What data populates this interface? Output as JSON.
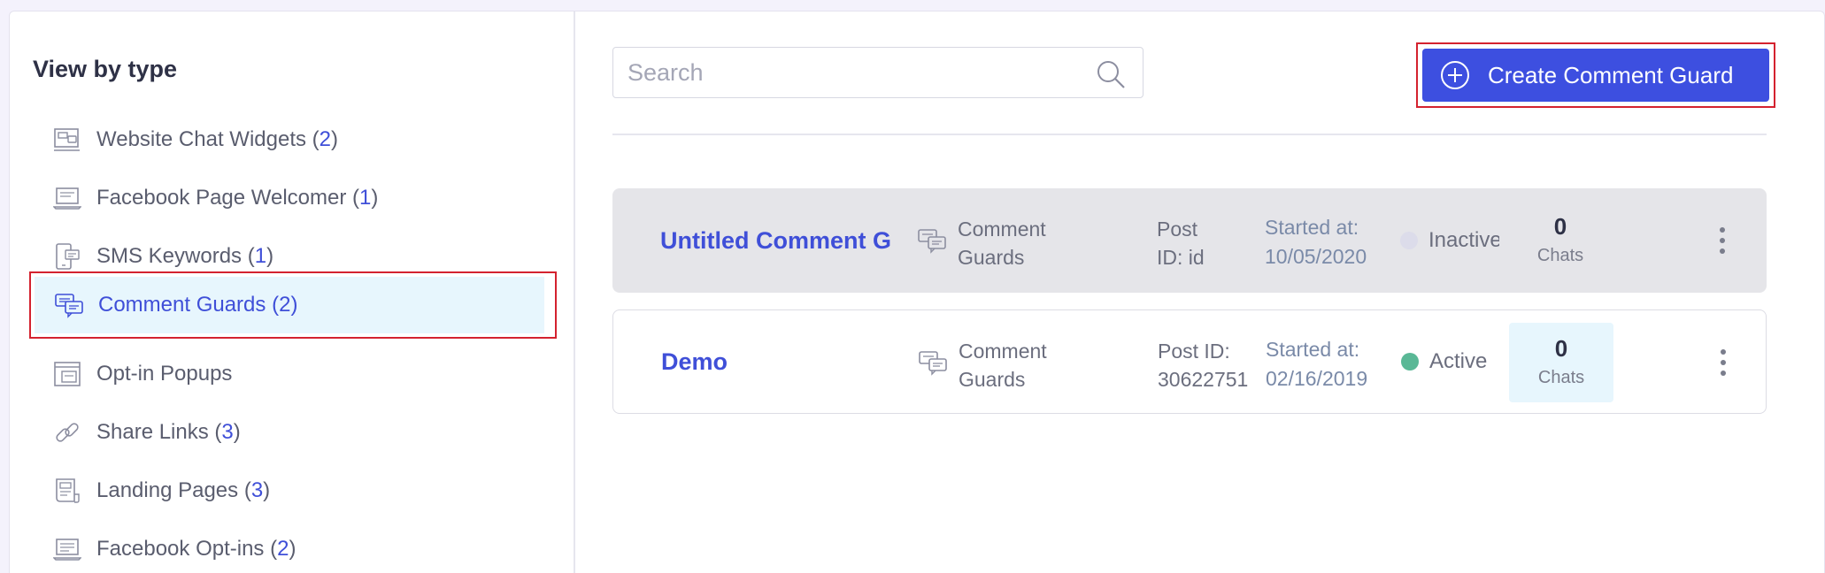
{
  "sidebar": {
    "title": "View by type",
    "items": [
      {
        "label": "Website Chat Widgets",
        "count": "2",
        "icon": "chat-widget-icon"
      },
      {
        "label": "Facebook Page Welcomer",
        "count": "1",
        "icon": "laptop-icon"
      },
      {
        "label": "SMS Keywords",
        "count": "1",
        "icon": "sms-phone-icon"
      },
      {
        "label": "Comment Guards",
        "count": "2",
        "icon": "comment-guard-icon",
        "active": true
      },
      {
        "label": "Opt-in Popups",
        "count": "",
        "icon": "popup-icon"
      },
      {
        "label": "Share Links",
        "count": "3",
        "icon": "link-icon"
      },
      {
        "label": "Landing Pages",
        "count": "3",
        "icon": "landing-page-icon"
      },
      {
        "label": "Facebook Opt-ins",
        "count": "2",
        "icon": "facebook-optin-icon"
      }
    ]
  },
  "search": {
    "placeholder": "Search",
    "value": ""
  },
  "create_button": {
    "label": "Create Comment Guard",
    "icon": "plus-circle-icon"
  },
  "rows": [
    {
      "name": "Untitled Comment G",
      "type_line1": "Comment",
      "type_line2": "Guards",
      "post_line1": "Post",
      "post_line2": "ID: id",
      "started_label": "Started at:",
      "started_date": "10/05/2020",
      "status": "Inactive",
      "status_color": "#dcdcea",
      "chats": "0",
      "chats_label": "Chats"
    },
    {
      "name": "Demo",
      "type_line1": "Comment",
      "type_line2": "Guards",
      "post_line1": "Post ID:",
      "post_line2": "30622751",
      "started_label": "Started at:",
      "started_date": "02/16/2019",
      "status": "Active",
      "status_color": "#5ab896",
      "chats": "0",
      "chats_label": "Chats"
    }
  ],
  "colors": {
    "accent": "#3d4fe0",
    "highlight_border": "#d4222f",
    "active_bg": "#e7f6fd"
  }
}
